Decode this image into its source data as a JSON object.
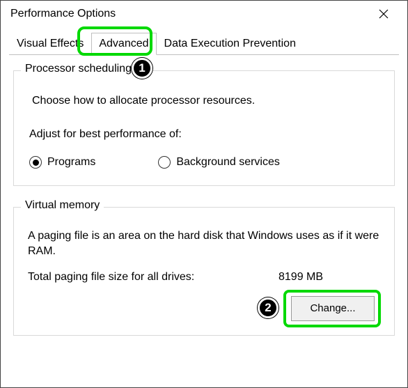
{
  "window": {
    "title": "Performance Options"
  },
  "tabs": {
    "visual_effects": "Visual Effects",
    "advanced": "Advanced",
    "dep": "Data Execution Prevention"
  },
  "processor": {
    "group_title": "Processor scheduling",
    "description": "Choose how to allocate processor resources.",
    "adjust_label": "Adjust for best performance of:",
    "option_programs": "Programs",
    "option_background": "Background services",
    "selected": "programs"
  },
  "virtual_memory": {
    "group_title": "Virtual memory",
    "description": "A paging file is an area on the hard disk that Windows uses as if it were RAM.",
    "total_label": "Total paging file size for all drives:",
    "total_value": "8199 MB",
    "change_button": "Change..."
  },
  "callouts": {
    "one": "1",
    "two": "2"
  }
}
